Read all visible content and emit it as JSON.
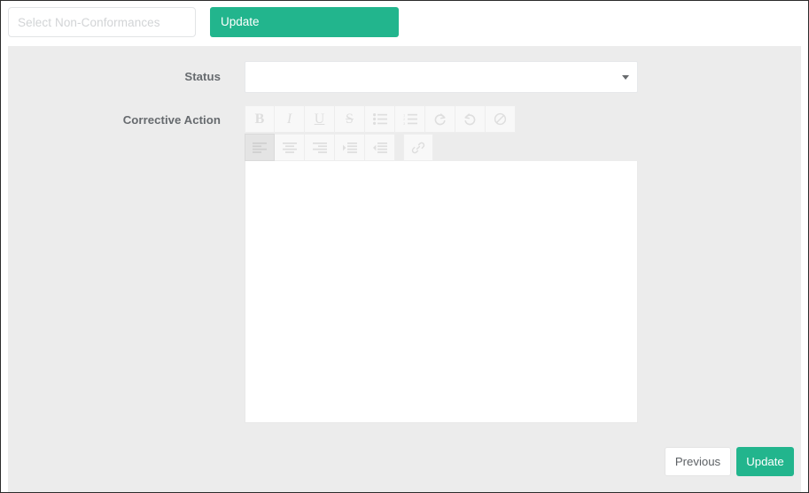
{
  "topbar": {
    "nonconformance_select": {
      "placeholder": "Select Non-Conformances",
      "value": ""
    },
    "update_label": "Update"
  },
  "form": {
    "status": {
      "label": "Status",
      "value": "",
      "caret_icon": "chevron-down-icon"
    },
    "corrective_action": {
      "label": "Corrective Action",
      "content": ""
    }
  },
  "editor_toolbar": {
    "row1": [
      {
        "name": "bold-icon",
        "glyph": "B",
        "title": "Bold",
        "active": false
      },
      {
        "name": "italic-icon",
        "glyph": "I",
        "title": "Italic",
        "active": false
      },
      {
        "name": "underline-icon",
        "glyph": "U",
        "title": "Underline",
        "active": false
      },
      {
        "name": "strikethrough-icon",
        "glyph": "S",
        "title": "Strikethrough",
        "active": false
      },
      {
        "name": "unordered-list-icon",
        "glyph": "",
        "title": "Bulleted list",
        "active": false
      },
      {
        "name": "ordered-list-icon",
        "glyph": "",
        "title": "Numbered list",
        "active": false
      },
      {
        "name": "redo-icon",
        "glyph": "",
        "title": "Redo",
        "active": false
      },
      {
        "name": "undo-icon",
        "glyph": "",
        "title": "Undo",
        "active": false
      },
      {
        "name": "clear-formatting-icon",
        "glyph": "",
        "title": "Remove formatting",
        "active": false
      }
    ],
    "row2": [
      {
        "name": "align-left-icon",
        "title": "Align left",
        "active": true
      },
      {
        "name": "align-center-icon",
        "title": "Align center",
        "active": false
      },
      {
        "name": "align-right-icon",
        "title": "Align right",
        "active": false
      },
      {
        "name": "indent-icon",
        "title": "Increase indent",
        "active": false
      },
      {
        "name": "outdent-icon",
        "title": "Decrease indent",
        "active": false
      },
      {
        "name": "link-icon",
        "title": "Insert link",
        "active": false
      }
    ]
  },
  "footer": {
    "previous_label": "Previous",
    "update_label": "Update"
  },
  "colors": {
    "accent": "#22b58d",
    "panel_bg": "#ececec",
    "page_bg": "#ffffff",
    "toolbar_icon": "#dedede",
    "label_text": "#666a6e"
  }
}
